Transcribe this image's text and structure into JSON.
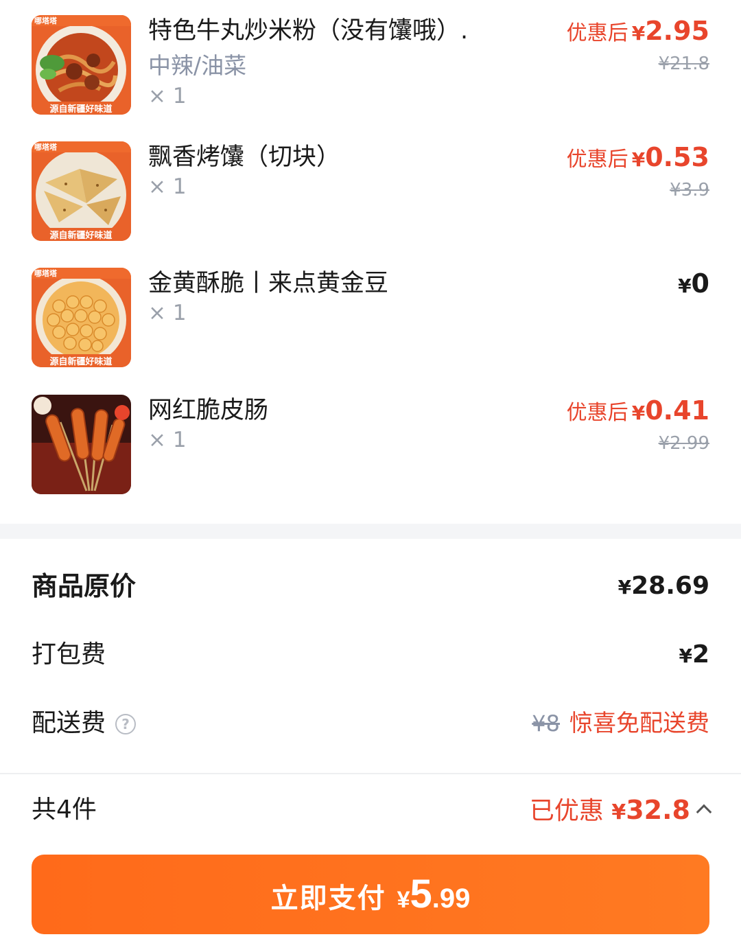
{
  "items": [
    {
      "name": "特色牛丸炒米粉（没有馕哦）.",
      "spec": "中辣/油菜",
      "qty": "× 1",
      "discount_label": "优惠后",
      "currency": "¥",
      "price": "2.95",
      "original_price": "¥21.8",
      "thumb_icon": "beef-ball-rice-noodles-photo",
      "thumb_banner": "源自新疆好味道"
    },
    {
      "name": "飘香烤馕（切块）",
      "qty": "× 1",
      "discount_label": "优惠后",
      "currency": "¥",
      "price": "0.53",
      "original_price": "¥3.9",
      "thumb_icon": "baked-naan-photo",
      "thumb_banner": "源自新疆好味道"
    },
    {
      "name": "金黄酥脆丨来点黄金豆",
      "qty": "× 1",
      "currency": "¥",
      "price": "0",
      "thumb_icon": "golden-beans-photo",
      "thumb_banner": "源自新疆好味道"
    },
    {
      "name": "网红脆皮肠",
      "qty": "× 1",
      "discount_label": "优惠后",
      "currency": "¥",
      "price": "0.41",
      "original_price": "¥2.99",
      "thumb_icon": "crispy-sausage-photo"
    }
  ],
  "summary": {
    "original_total_label": "商品原价",
    "original_total_currency": "¥",
    "original_total": "28.69",
    "packing_fee_label": "打包费",
    "packing_fee_currency": "¥",
    "packing_fee": "2",
    "delivery_fee_label": "配送费",
    "delivery_fee_original": "¥8",
    "delivery_fee_note": "惊喜免配送费",
    "count_label": "共4件",
    "discount_label": "已优惠",
    "discount_currency": "¥",
    "discount_amount": "32.8"
  },
  "pay_button": {
    "label": "立即支付",
    "currency": "¥",
    "amount_int": "5",
    "amount_dec": ".99"
  },
  "colors": {
    "accent_red": "#e8452c",
    "button_orange": "#ff6a1a",
    "muted": "#9aa0aa"
  }
}
